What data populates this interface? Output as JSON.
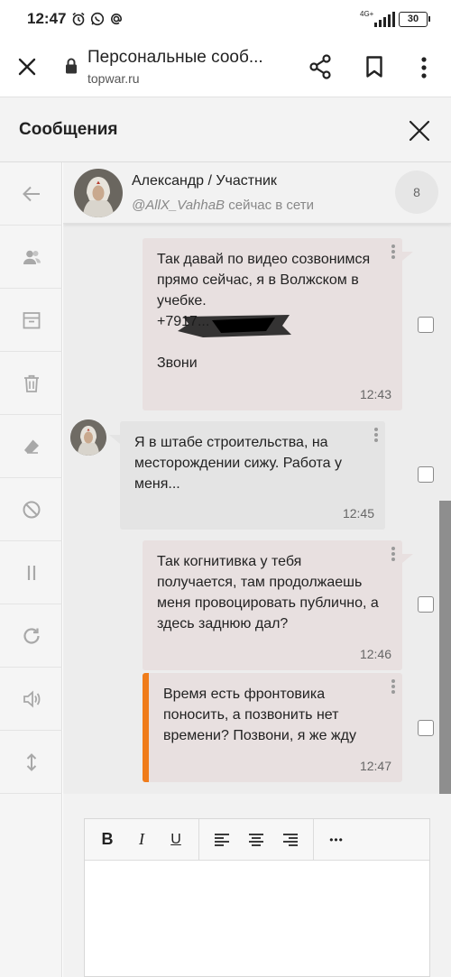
{
  "status_bar": {
    "time": "12:47",
    "notification_icons": [
      "alarm-icon",
      "whatsapp-icon",
      "at-icon"
    ],
    "network_label": "4G+",
    "battery": "30"
  },
  "browser": {
    "title": "Персональные сооб...",
    "url": "topwar.ru",
    "icons": [
      "close-icon",
      "lock-icon",
      "share-icon",
      "bookmark-icon",
      "more-icon"
    ]
  },
  "panel": {
    "title": "Сообщения"
  },
  "sidebar_tools": [
    "back-arrow-icon",
    "users-icon",
    "archive-icon",
    "trash-icon",
    "eraser-icon",
    "block-icon",
    "pause-icon",
    "refresh-icon",
    "volume-icon",
    "expand-vertical-icon"
  ],
  "contact": {
    "name": "Александр / Участник",
    "handle": "@AllX_VahhaB",
    "status": "сейчас в сети",
    "badge": "8"
  },
  "messages": [
    {
      "direction": "out",
      "text": "Так давай по видео созвонимся прямо сейчас, я в Волжском в учебке.\n+7917...\n\nЗвони",
      "time": "12:43"
    },
    {
      "direction": "in",
      "text": "Я в штабе строительства, на месторождении сижу. Работа у меня...",
      "time": "12:45"
    },
    {
      "direction": "out",
      "text": "Так когнитивка у тебя получается, там продолжаешь меня провоцировать публично, а здесь заднюю дал?",
      "time": "12:46"
    },
    {
      "direction": "out",
      "text": "Время есть фронтовика поносить, а позвонить нет времени? Позвони, я же жду",
      "time": "12:47"
    }
  ],
  "editor": {
    "bold": "B",
    "italic": "I",
    "underline": "U",
    "more": "•••"
  },
  "colors": {
    "accent": "#f07c1a",
    "panel_bg": "#f3f3f3",
    "chat_bg": "#ededed"
  }
}
